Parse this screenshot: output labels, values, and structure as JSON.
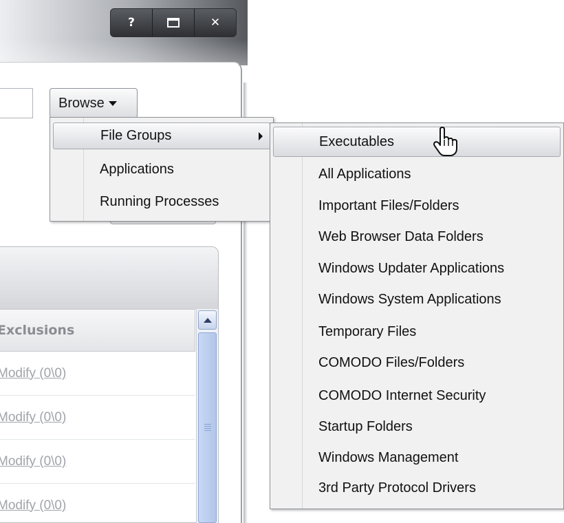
{
  "window": {
    "buttons": [
      {
        "name": "help-button",
        "glyph": "?"
      },
      {
        "name": "maximize-button",
        "glyph": ""
      },
      {
        "name": "close-button",
        "glyph": "✕"
      }
    ]
  },
  "browse": {
    "label": "Browse"
  },
  "exclusions": {
    "column_header": "Exclusions",
    "rows": [
      "Modify (0\\0)",
      "Modify (0\\0)",
      "Modify (0\\0)",
      "Modify (0\\0)"
    ]
  },
  "browse_menu": {
    "items": [
      {
        "label": "File Groups",
        "has_submenu": true,
        "selected": true
      },
      {
        "label": "Applications",
        "has_submenu": false,
        "selected": false
      },
      {
        "label": "Running Processes",
        "has_submenu": false,
        "selected": false
      }
    ]
  },
  "file_groups_menu": {
    "items": [
      "Executables",
      "All Applications",
      "Important Files/Folders",
      "Web Browser Data Folders",
      "Windows Updater Applications",
      "Windows System Applications",
      "Temporary Files",
      "COMODO Files/Folders",
      "COMODO Internet Security",
      "Startup Folders",
      "Windows Management",
      "3rd Party Protocol Drivers"
    ],
    "selected": "Executables"
  },
  "cursor": {
    "icon": "hand-pointer-icon"
  }
}
